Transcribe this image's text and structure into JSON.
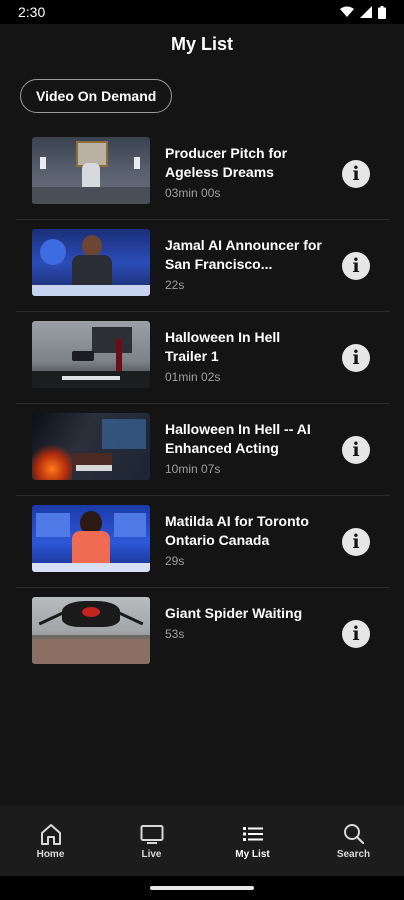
{
  "status_bar": {
    "time": "2:30"
  },
  "header": {
    "title": "My List"
  },
  "filter": {
    "chip_label": "Video On Demand"
  },
  "items": [
    {
      "title": "Producer Pitch for Ageless Dreams",
      "duration": "03min 00s"
    },
    {
      "title": "Jamal AI Announcer for San Francisco...",
      "duration": "22s"
    },
    {
      "title": "Halloween In Hell Trailer 1",
      "duration": "01min 02s"
    },
    {
      "title": "Halloween In Hell -- AI Enhanced Acting",
      "duration": "10min 07s"
    },
    {
      "title": "Matilda AI for Toronto Ontario Canada",
      "duration": "29s"
    },
    {
      "title": "Giant Spider Waiting",
      "duration": "53s"
    }
  ],
  "nav": {
    "home": "Home",
    "live": "Live",
    "mylist": "My List",
    "search": "Search"
  },
  "colors": {
    "background": "#141414",
    "nav_bg": "#1c1c1c",
    "info_btn": "#e6e6e6"
  }
}
